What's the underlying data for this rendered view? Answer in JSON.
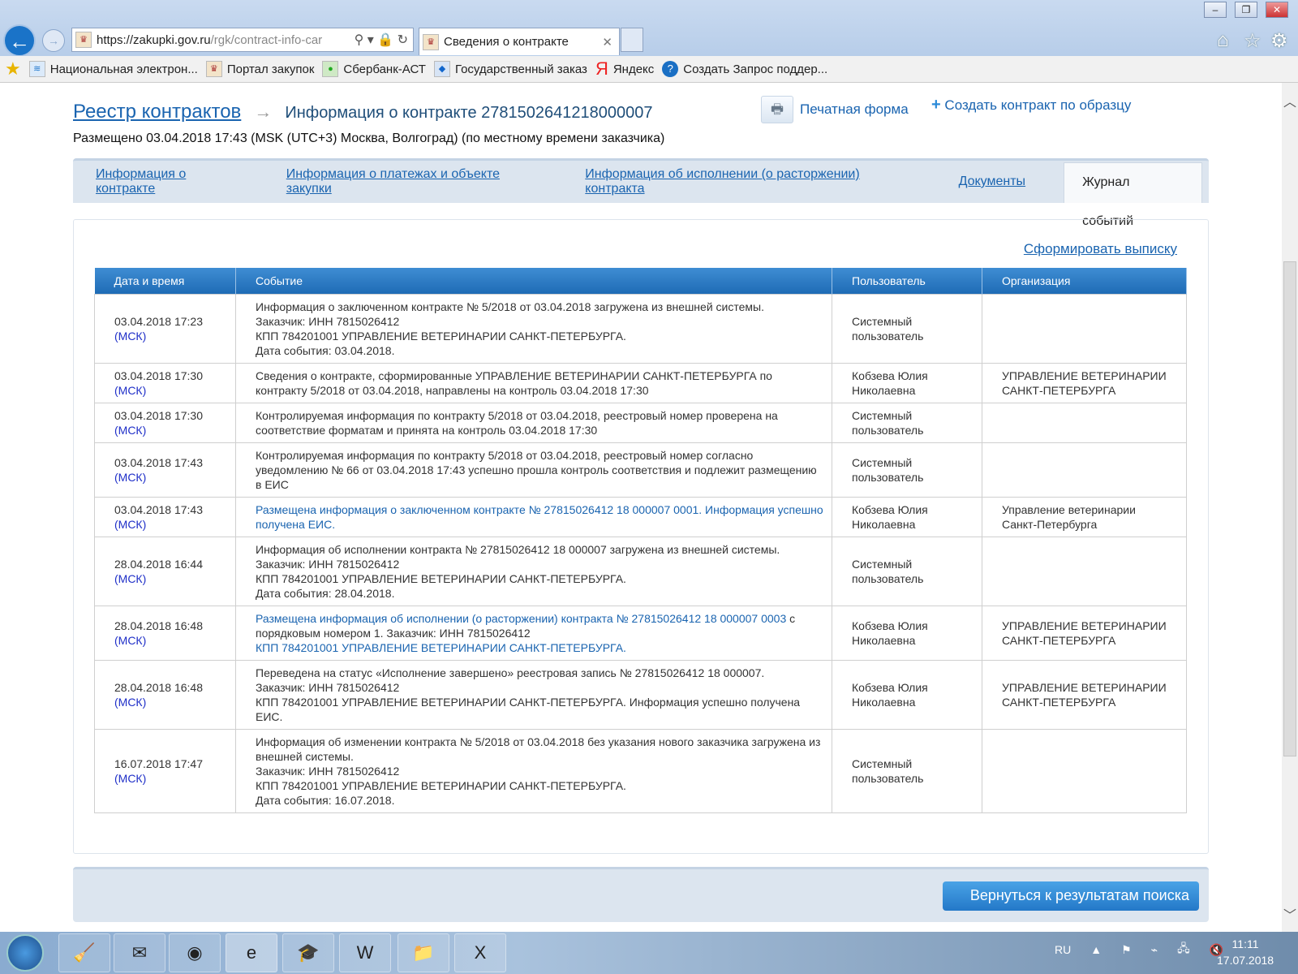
{
  "browser": {
    "url_host": "https://zakupki.gov.ru",
    "url_path": "/rgk/contract-info-car",
    "tab_title": "Сведения о контракте",
    "favorites": [
      "Национальная электрон...",
      "Портал закупок",
      "Сбербанк-АСТ",
      "Государственный заказ",
      "Яндекс",
      "Создать Запрос поддер..."
    ]
  },
  "header": {
    "breadcrumb_root": "Реестр контрактов",
    "title": "Информация о контракте 2781502641218000007",
    "posted": "Размещено 03.04.2018 17:43 (MSK (UTC+3) Москва, Волгоград) (по местному времени заказчика)",
    "print_label": "Печатная форма",
    "create_label": "Создать контракт по образцу"
  },
  "tabs": [
    "Информация о контракте",
    "Информация о платежах и объекте закупки",
    "Информация об исполнении (о расторжении) контракта",
    "Документы",
    "Журнал событий"
  ],
  "active_tab": "Журнал событий",
  "extract_label": "Сформировать выписку",
  "table": {
    "headers": [
      "Дата и время",
      "Событие",
      "Пользователь",
      "Организация"
    ],
    "tz": "(МСК)",
    "rows": [
      {
        "date": "03.04.2018 17:23",
        "event": [
          "Информация о заключенном контракте № 5/2018 от 03.04.2018 загружена из внешней системы.",
          "Заказчик: ИНН 7815026412",
          "КПП 784201001 УПРАВЛЕНИЕ ВЕТЕРИНАРИИ САНКТ-ПЕТЕРБУРГА.",
          "Дата события: 03.04.2018."
        ],
        "user": [
          "Системный",
          "пользователь"
        ],
        "org": [
          "",
          ""
        ]
      },
      {
        "date": "03.04.2018 17:30",
        "event": [
          "Сведения о контракте, сформированные УПРАВЛЕНИЕ ВЕТЕРИНАРИИ САНКТ-ПЕТЕРБУРГА по контракту 5/2018 от 03.04.2018, направлены на контроль 03.04.2018 17:30"
        ],
        "user": [
          "Кобзева Юлия",
          "Николаевна"
        ],
        "org": [
          "УПРАВЛЕНИЕ ВЕТЕРИНАРИИ",
          "САНКТ-ПЕТЕРБУРГА"
        ]
      },
      {
        "date": "03.04.2018 17:30",
        "event": [
          "Контролируемая информация по контракту 5/2018 от 03.04.2018, реестровый номер проверена на соответствие форматам и принята на контроль 03.04.2018 17:30"
        ],
        "user": [
          "Системный",
          "пользователь"
        ],
        "org": [
          "",
          ""
        ]
      },
      {
        "date": "03.04.2018 17:43",
        "event": [
          "Контролируемая информация по контракту 5/2018 от 03.04.2018, реестровый номер согласно уведомлению № 66 от 03.04.2018 17:43 успешно прошла контроль соответствия и подлежит размещению в ЕИС"
        ],
        "user": [
          "Системный",
          "пользователь"
        ],
        "org": [
          "",
          ""
        ]
      },
      {
        "date": "03.04.2018 17:43",
        "event_link": "Размещена информация о заключенном контракте № 27815026412 18 000007 0001. Информация успешно получена ЕИС.",
        "user": [
          "Кобзева Юлия",
          "Николаевна"
        ],
        "org": [
          "Управление ветеринарии",
          "Санкт-Петербурга"
        ]
      },
      {
        "date": "28.04.2018 16:44",
        "event": [
          "Информация об исполнении контракта № 27815026412 18 000007 загружена из внешней системы.",
          "Заказчик: ИНН 7815026412",
          "КПП 784201001 УПРАВЛЕНИЕ ВЕТЕРИНАРИИ САНКТ-ПЕТЕРБУРГА.",
          "Дата события: 28.04.2018."
        ],
        "user": [
          "Системный",
          "пользователь"
        ],
        "org": [
          "",
          ""
        ]
      },
      {
        "date": "28.04.2018 16:48",
        "event_link": "Размещена информация об исполнении (о расторжении) контракта № 27815026412 18 000007 0003",
        "event_mid": " с порядковым номером 1. Заказчик: ИНН 7815026412",
        "event_link2": "КПП 784201001 УПРАВЛЕНИЕ ВЕТЕРИНАРИИ САНКТ-ПЕТЕРБУРГА.",
        "user": [
          "Кобзева Юлия",
          "Николаевна"
        ],
        "org": [
          "УПРАВЛЕНИЕ ВЕТЕРИНАРИИ",
          "САНКТ-ПЕТЕРБУРГА"
        ]
      },
      {
        "date": "28.04.2018 16:48",
        "event": [
          "Переведена на статус «Исполнение завершено» реестровая запись № 27815026412 18 000007.",
          "Заказчик: ИНН 7815026412",
          "КПП 784201001 УПРАВЛЕНИЕ ВЕТЕРИНАРИИ САНКТ-ПЕТЕРБУРГА. Информация успешно получена ЕИС."
        ],
        "user": [
          "Кобзева Юлия",
          "Николаевна"
        ],
        "org": [
          "УПРАВЛЕНИЕ ВЕТЕРИНАРИИ",
          "САНКТ-ПЕТЕРБУРГА"
        ]
      },
      {
        "date": "16.07.2018 17:47",
        "event": [
          "Информация об изменении контракта № 5/2018 от 03.04.2018 без указания нового заказчика загружена из внешней системы.",
          "Заказчик: ИНН 7815026412",
          "КПП 784201001 УПРАВЛЕНИЕ ВЕТЕРИНАРИИ САНКТ-ПЕТЕРБУРГА.",
          "Дата события: 16.07.2018."
        ],
        "user": [
          "Системный",
          "пользователь"
        ],
        "org": [
          "",
          ""
        ]
      }
    ]
  },
  "footer": {
    "back_label": "Вернуться к результатам поиска"
  },
  "taskbar": {
    "lang": "RU",
    "time": "11:11",
    "date": "17.07.2018"
  }
}
